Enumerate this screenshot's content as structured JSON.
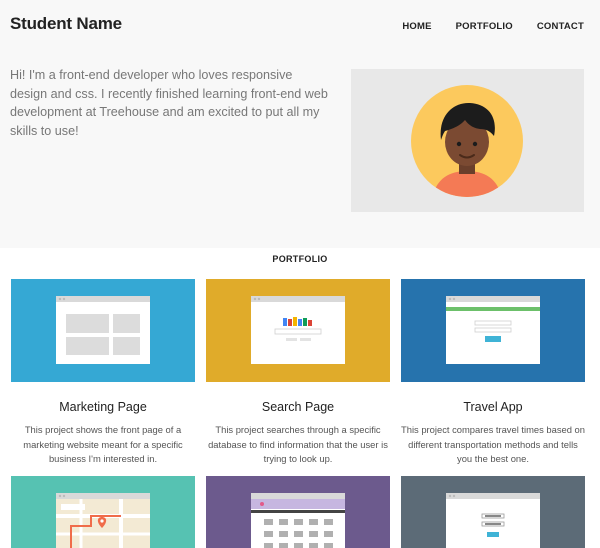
{
  "header": {
    "brand": "Student Name",
    "nav": [
      "HOME",
      "PORTFOLIO",
      "CONTACT"
    ]
  },
  "intro": {
    "text": "Hi! I'm a front-end developer who loves responsive design and css. I recently finished learning front-end web development at Treehouse and am excited to put all my skills to use!"
  },
  "portfolio": {
    "heading": "PORTFOLIO",
    "projects": [
      {
        "title": "Marketing Page",
        "description": "This project shows the front page of a marketing website meant for a specific business I'm interested in.",
        "color": "#35a8d4"
      },
      {
        "title": "Search Page",
        "description": "This project searches through a specific database to find information that the user is trying to look up.",
        "color": "#e0ab2a"
      },
      {
        "title": "Travel App",
        "description": "This project compares travel times based on different transportation methods and tells you the best one.",
        "color": "#2673ad"
      },
      {
        "color": "#56c2b2"
      },
      {
        "color": "#6c5a8d"
      },
      {
        "color": "#5c6b77"
      }
    ]
  },
  "colors": {
    "top_bg": "#f8f8f8",
    "avatar_bg": "#e8e8e8"
  }
}
